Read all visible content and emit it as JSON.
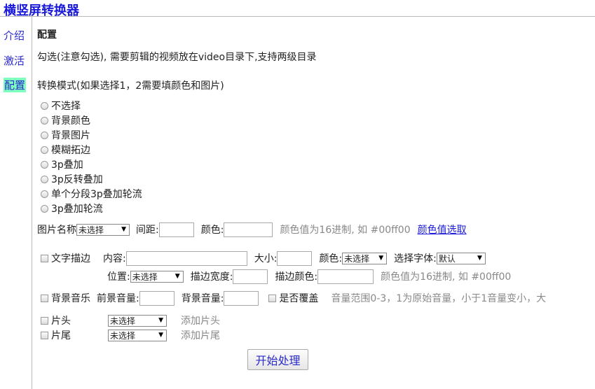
{
  "app": {
    "title": "横竖屏转换器"
  },
  "nav": [
    {
      "label": "介绍"
    },
    {
      "label": "激活"
    },
    {
      "label": "配置"
    }
  ],
  "page": {
    "section_title": "配置",
    "description": "勾选(注意勾选), 需要剪辑的视频放在video目录下,支持两级目录",
    "mode_title": "转换模式(如果选择1，2需要填颜色和图片)"
  },
  "modes": [
    {
      "label": "不选择"
    },
    {
      "label": "背景颜色"
    },
    {
      "label": "背景图片"
    },
    {
      "label": "模糊拓边"
    },
    {
      "label": "3p叠加"
    },
    {
      "label": "3p反转叠加"
    },
    {
      "label": "单个分段3p叠加轮流"
    },
    {
      "label": "3p叠加轮流"
    }
  ],
  "image_row": {
    "image_name_label": "图片名称",
    "image_select": "未选择",
    "spacing_label": "间距:",
    "spacing_value": "",
    "color_label": "颜色:",
    "color_value": "",
    "hint": "颜色值为16进制, 如 #00ff00",
    "link": "颜色值选取"
  },
  "text_stroke": {
    "checkbox_label": "文字描边",
    "content_label": "内容:",
    "content_value": "",
    "size_label": "大小:",
    "size_value": "",
    "color_label": "颜色:",
    "color_select": "未选择",
    "font_label": "选择字体:",
    "font_select": "默认",
    "position_label": "位置:",
    "position_select": "未选择",
    "stroke_width_label": "描边宽度:",
    "stroke_width_value": "",
    "stroke_color_label": "描边颜色:",
    "stroke_color_value": "",
    "hint": "颜色值为16进制, 如 #00ff00"
  },
  "bgm": {
    "checkbox_label": "背景音乐",
    "fg_volume_label": "前景音量:",
    "fg_volume_value": "",
    "bg_volume_label": "背景音量:",
    "bg_volume_value": "",
    "overwrite_label": "是否覆盖",
    "hint": "音量范围0-3，1为原始音量，小于1音量变小，大"
  },
  "intro": {
    "checkbox_label": "片头",
    "select": "未选择",
    "add_label": "添加片头"
  },
  "outro": {
    "checkbox_label": "片尾",
    "select": "未选择",
    "add_label": "添加片尾"
  },
  "actions": {
    "start_label": "开始处理"
  }
}
